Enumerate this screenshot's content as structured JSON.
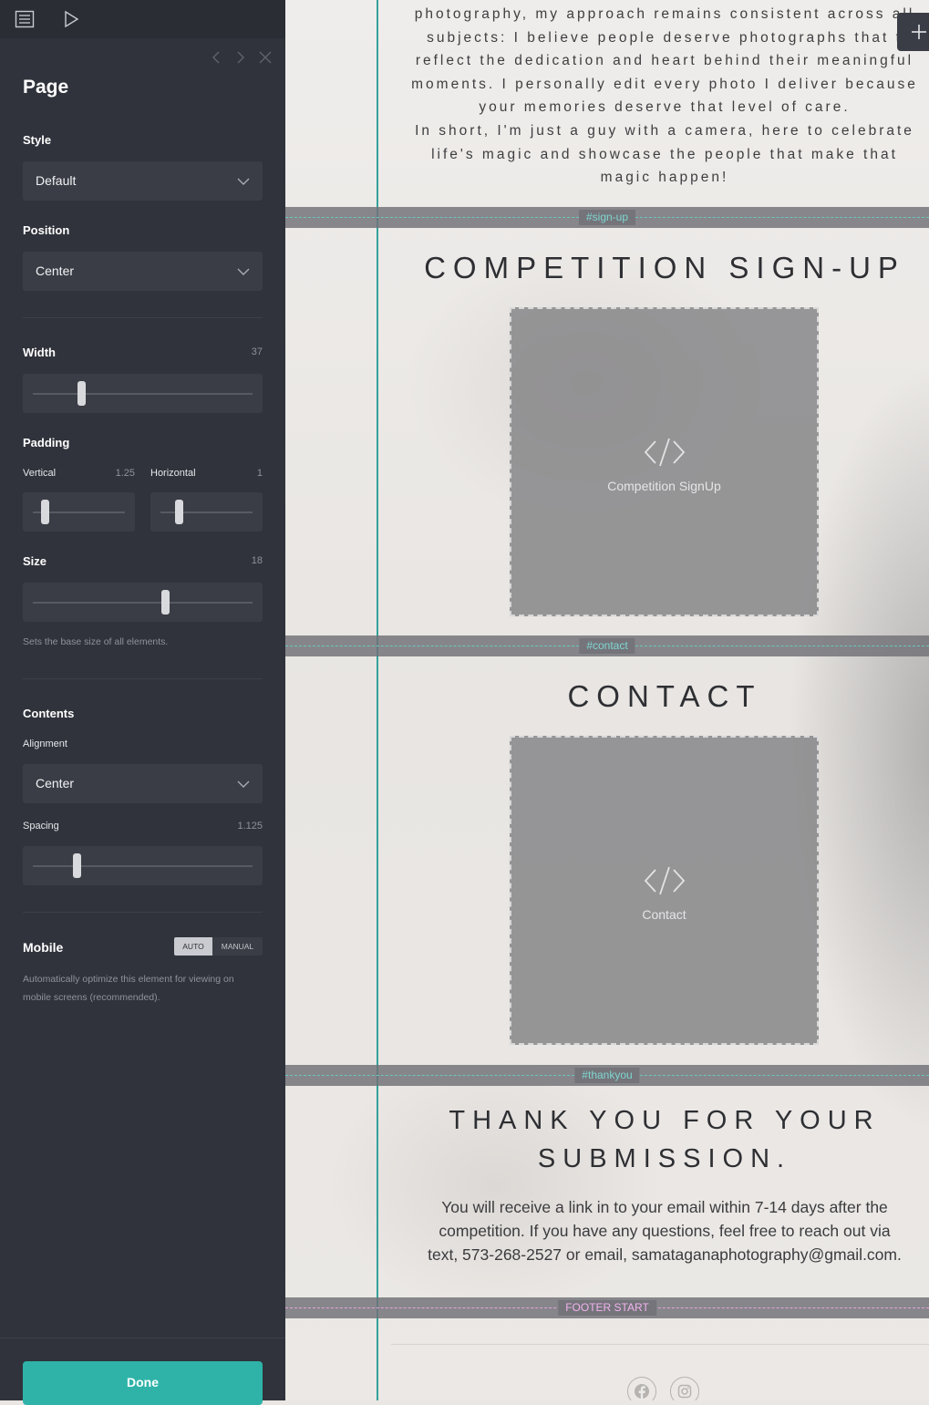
{
  "panel": {
    "title": "Page",
    "style": {
      "label": "Style",
      "value": "Default"
    },
    "position": {
      "label": "Position",
      "value": "Center"
    },
    "width": {
      "label": "Width",
      "value": "37",
      "fraction": 0.22
    },
    "padding": {
      "label": "Padding",
      "vertical": {
        "label": "Vertical",
        "value": "1.25",
        "fraction": 0.13
      },
      "horizontal": {
        "label": "Horizontal",
        "value": "1",
        "fraction": 0.2
      }
    },
    "size": {
      "label": "Size",
      "value": "18",
      "fraction": 0.6,
      "help": "Sets the base size of all elements."
    },
    "contents": {
      "label": "Contents",
      "alignment": {
        "label": "Alignment",
        "value": "Center"
      },
      "spacing": {
        "label": "Spacing",
        "value": "1.125",
        "fraction": 0.2
      }
    },
    "mobile": {
      "label": "Mobile",
      "auto_label": "AUTO",
      "manual_label": "MANUAL",
      "help": "Automatically optimize this element for viewing on mobile screens (recommended)."
    },
    "done_label": "Done"
  },
  "canvas": {
    "about_lines": [
      "photography, my approach remains consistent across all",
      "subjects: I believe people deserve photographs that t",
      "reflect the dedication and heart behind their meaningful",
      "moments. I personally edit every photo I deliver because",
      "your memories deserve that level of care.",
      "In short, I'm just a guy with a camera, here to celebrate",
      "life's magic and showcase the people that make that",
      "magic happen!"
    ],
    "sections": {
      "signup": {
        "tag": "#sign-up",
        "heading": "COMPETITION SIGN-UP",
        "embed_label": "Competition SignUp"
      },
      "contact": {
        "tag": "#contact",
        "heading": "CONTACT",
        "embed_label": "Contact"
      },
      "thankyou": {
        "tag": "#thankyou",
        "heading_line1": "THANK YOU FOR YOUR",
        "heading_line2": "SUBMISSION.",
        "body_lines": [
          "You will receive a link in to your email within 7-14 days after the",
          "competition. If you have any questions, feel free to reach out via",
          "text, 573-268-2527 or email, samataganaphotography@gmail.com."
        ]
      },
      "footer": {
        "tag": "FOOTER START"
      }
    },
    "social_icons": [
      "facebook-icon",
      "instagram-icon"
    ]
  },
  "colors": {
    "accent": "#2fb3a8",
    "panel_bg": "#30333b",
    "guide": "#34a29a",
    "footer_tag": "#f2b3ef"
  }
}
